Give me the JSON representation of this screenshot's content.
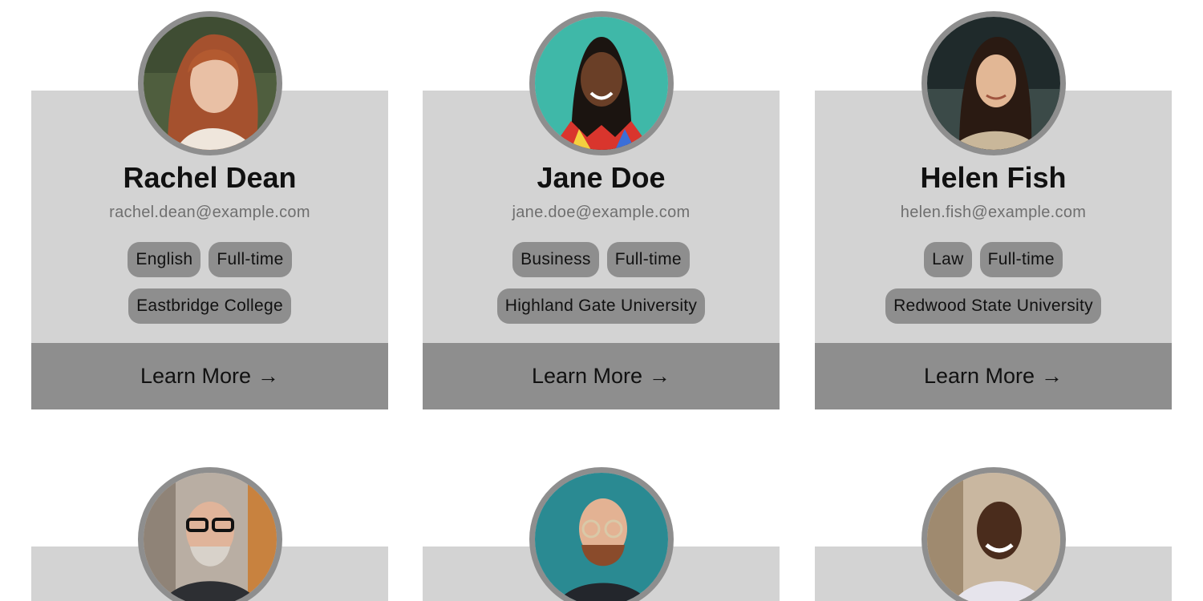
{
  "cards": [
    {
      "name": "Rachel Dean",
      "email": "rachel.dean@example.com",
      "tags": [
        "English",
        "Full-time"
      ],
      "institution": "Eastbridge College",
      "cta": "Learn More",
      "arrow": "→"
    },
    {
      "name": "Jane Doe",
      "email": "jane.doe@example.com",
      "tags": [
        "Business",
        "Full-time"
      ],
      "institution": "Highland Gate University",
      "cta": "Learn More",
      "arrow": "→"
    },
    {
      "name": "Helen Fish",
      "email": "helen.fish@example.com",
      "tags": [
        "Law",
        "Full-time"
      ],
      "institution": "Redwood State University",
      "cta": "Learn More",
      "arrow": "→"
    }
  ],
  "colors": {
    "page_background": "#ffffff",
    "card_background": "#d3d3d3",
    "accent_gray": "#8e8e8e",
    "text_dark": "#111111",
    "email_gray": "#6f6f6f"
  }
}
